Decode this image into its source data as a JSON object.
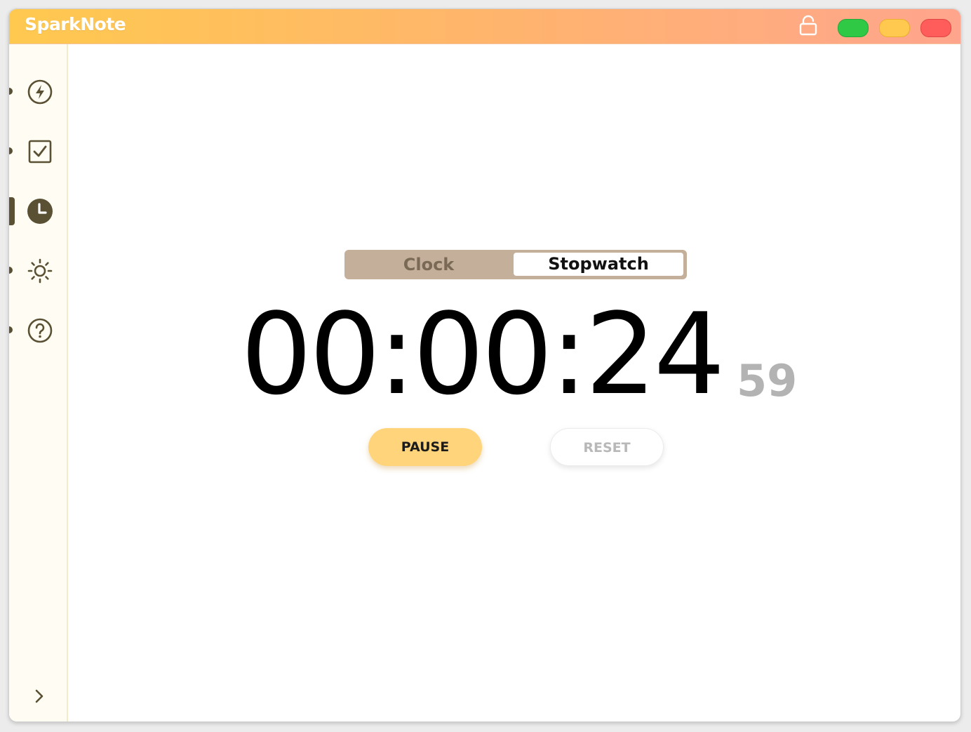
{
  "app": {
    "title": "SparkNote"
  },
  "titlebar": {
    "icons": [
      "lock-open-icon"
    ],
    "window_buttons": [
      {
        "name": "maximize",
        "color": "#2fc946"
      },
      {
        "name": "minimize",
        "color": "#ffc94f"
      },
      {
        "name": "close",
        "color": "#ff5c5c"
      }
    ]
  },
  "sidebar": {
    "items": [
      {
        "icon": "lightning-icon",
        "active": false
      },
      {
        "icon": "checkbox-icon",
        "active": false
      },
      {
        "icon": "clock-icon",
        "active": true
      },
      {
        "icon": "sun-icon",
        "active": false
      },
      {
        "icon": "help-icon",
        "active": false
      }
    ],
    "expand_icon": "chevron-right-icon"
  },
  "toggle": {
    "options": [
      "Clock",
      "Stopwatch"
    ],
    "selected": "Stopwatch"
  },
  "stopwatch": {
    "time": "00:00:24",
    "centiseconds": "59"
  },
  "buttons": {
    "pause_label": "PAUSE",
    "reset_label": "RESET"
  },
  "colors": {
    "accent": "#ffd47a",
    "sidebar_icon": "#5a5033",
    "toggle_bg": "#c4b09a"
  }
}
